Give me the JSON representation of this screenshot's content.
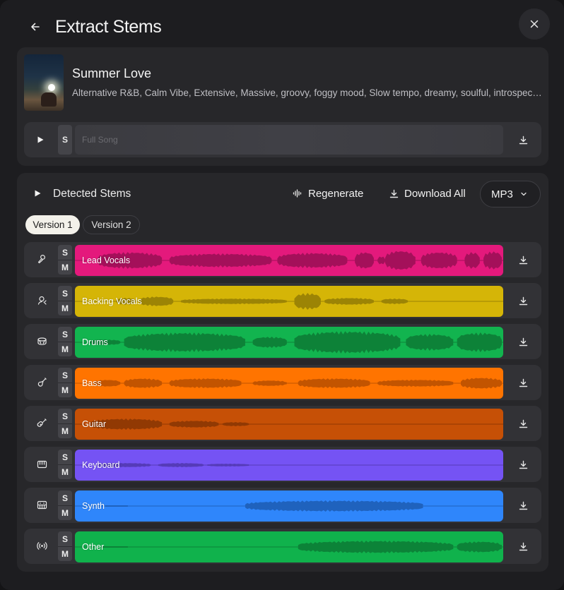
{
  "header": {
    "title": "Extract Stems"
  },
  "song": {
    "title": "Summer Love",
    "tags": "Alternative R&B, Calm Vibe, Extensive, Massive, groovy, foggy mood, Slow tempo, dreamy, soulful, introspective, romantic, late night",
    "full_label": "Full Song",
    "solo_label": "S"
  },
  "stems_panel": {
    "title": "Detected Stems",
    "regenerate_label": "Regenerate",
    "download_all_label": "Download All",
    "format": "MP3",
    "versions": [
      {
        "label": "Version 1",
        "active": true
      },
      {
        "label": "Version 2",
        "active": false
      }
    ]
  },
  "stems": [
    {
      "label": "Lead Vocals",
      "solo": "S",
      "mute": "M",
      "icon": "microphone-icon",
      "color": "#e4197c",
      "wave": "#a4105a"
    },
    {
      "label": "Backing Vocals",
      "solo": "S",
      "mute": "M",
      "icon": "singer-icon",
      "color": "#d5b507",
      "wave": "#9c8405"
    },
    {
      "label": "Drums",
      "solo": "S",
      "mute": "M",
      "icon": "drum-icon",
      "color": "#12b44f",
      "wave": "#0d8238"
    },
    {
      "label": "Bass",
      "solo": "S",
      "mute": "M",
      "icon": "bass-guitar-icon",
      "color": "#ff7400",
      "wave": "#c25400"
    },
    {
      "label": "Guitar",
      "solo": "S",
      "mute": "M",
      "icon": "guitar-icon",
      "color": "#c65006",
      "wave": "#913903"
    },
    {
      "label": "Keyboard",
      "solo": "S",
      "mute": "M",
      "icon": "keyboard-icon",
      "color": "#7553f4",
      "wave": "#553bb8"
    },
    {
      "label": "Synth",
      "solo": "S",
      "mute": "M",
      "icon": "synth-icon",
      "color": "#2f86fb",
      "wave": "#1f62bd"
    },
    {
      "label": "Other",
      "solo": "S",
      "mute": "M",
      "icon": "radio-waves-icon",
      "color": "#10b24c",
      "wave": "#0c8338"
    }
  ],
  "icons": {
    "back": "arrow-left-icon",
    "close": "close-icon",
    "play": "play-icon",
    "download": "download-icon",
    "regenerate": "waveform-icon",
    "chevron": "chevron-down-icon"
  }
}
